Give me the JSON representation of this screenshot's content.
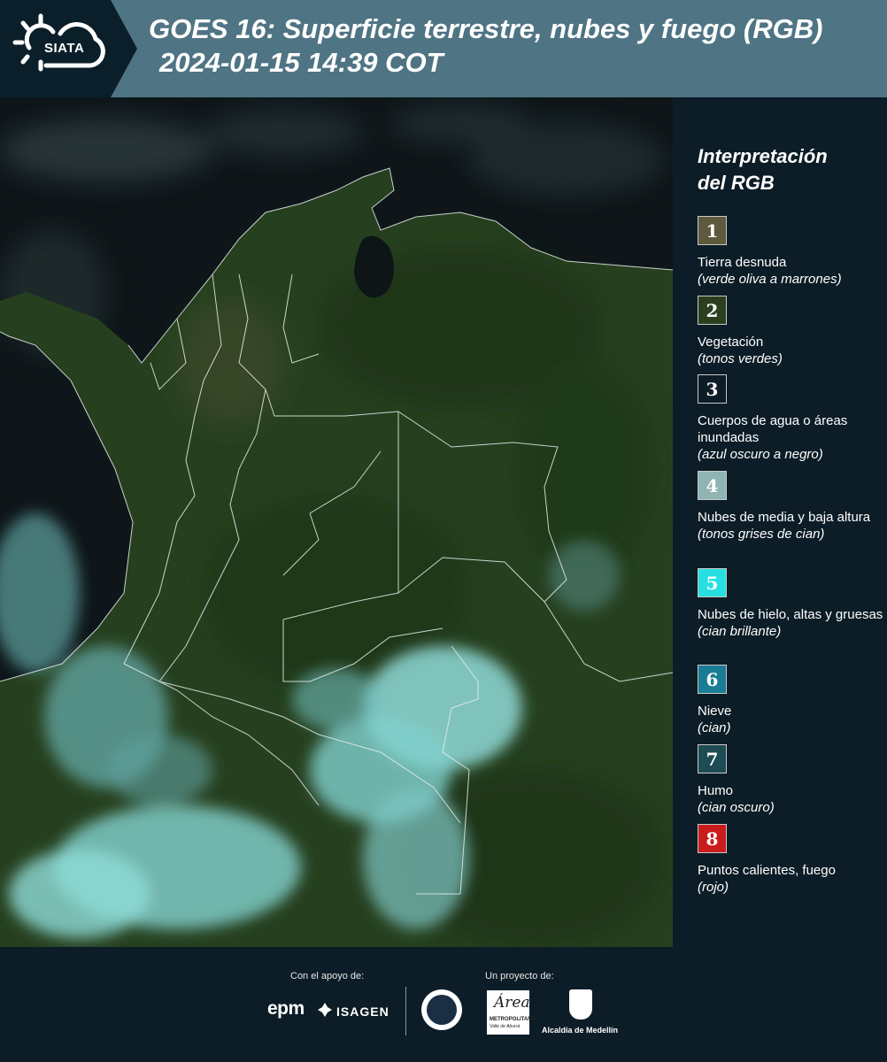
{
  "header": {
    "logo_text": "SIATA",
    "title": "GOES 16: Superficie terrestre, nubes y fuego (RGB)",
    "subtitle": "2024-01-15 14:39 COT"
  },
  "legend": {
    "title_line1": "Interpretación",
    "title_line2": "del RGB",
    "items": [
      {
        "num": "1",
        "label": "Tierra desnuda",
        "desc": "(verde oliva a marrones)",
        "color": "#5e5a3e",
        "text_color": "#ffffff"
      },
      {
        "num": "2",
        "label": "Vegetación",
        "desc": "(tonos verdes)",
        "color": "#2b3f1f",
        "text_color": "#ffffff"
      },
      {
        "num": "3",
        "label": "Cuerpos de agua o áreas inundadas",
        "desc": "(azul oscuro a negro)",
        "color": "#0c1d27",
        "text_color": "#ffffff"
      },
      {
        "num": "4",
        "label": "Nubes de media y baja altura",
        "desc": "(tonos grises de cian)",
        "color": "#8fb4b3",
        "text_color": "#ffffff"
      },
      {
        "num": "5",
        "label": "Nubes de hielo, altas y gruesas",
        "desc": "(cian brillante)",
        "color": "#27dfe0",
        "text_color": "#ffffff"
      },
      {
        "num": "6",
        "label": "Nieve",
        "desc": "(cian)",
        "color": "#1b7c96",
        "text_color": "#ffffff"
      },
      {
        "num": "7",
        "label": "Humo",
        "desc": "(cian oscuro)",
        "color": "#1d4c54",
        "text_color": "#ffffff"
      },
      {
        "num": "8",
        "label": "Puntos calientes, fuego",
        "desc": "(rojo)",
        "color": "#cb1c1d",
        "text_color": "#ffffff"
      }
    ]
  },
  "footer": {
    "support_label": "Con el apoyo de:",
    "project_label": "Un proyecto de:",
    "sponsor1": "epm",
    "sponsor2": "ISAGEN",
    "area_logo_main": "Área",
    "area_logo_line1": "METROPOLITANA",
    "area_logo_line2": "Valle de Aburrá",
    "alcaldia": "Alcaldía de Medellín"
  },
  "colors": {
    "header_bg": "#4f7483",
    "panel_bg": "#0c1d27",
    "land": "#27401f",
    "cloud": "#8ad8d8",
    "border": "#dfe7e7"
  }
}
